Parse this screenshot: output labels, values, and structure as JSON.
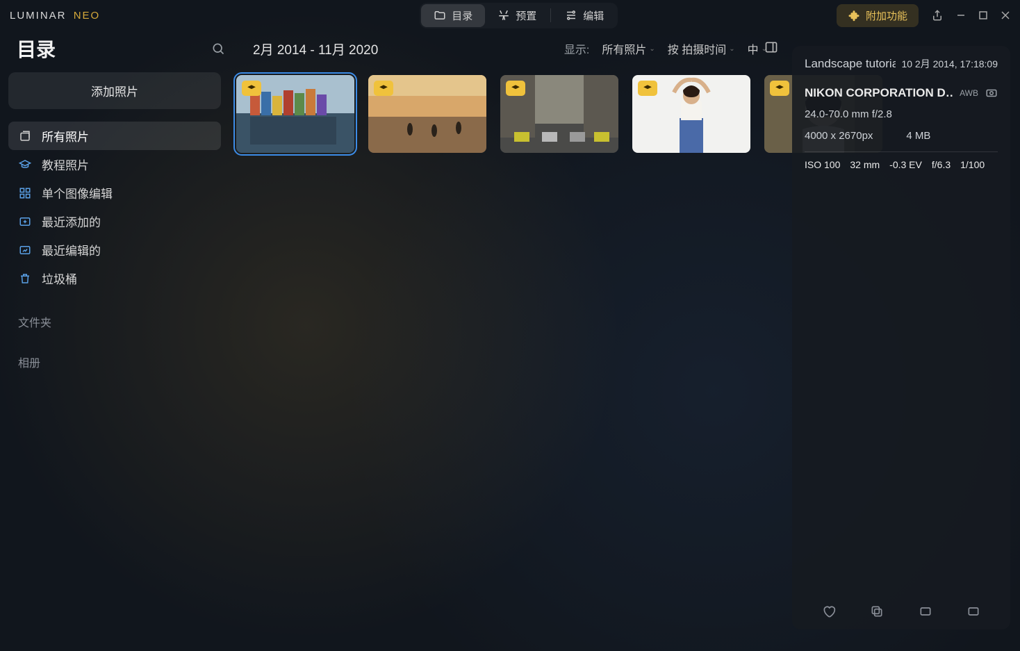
{
  "app": {
    "logo_a": "LUMINAR",
    "logo_b": "NEO"
  },
  "tabs": {
    "catalog": "目录",
    "presets": "预置",
    "edit": "编辑"
  },
  "addon_label": "附加功能",
  "sidebar_title": "目录",
  "date_range": "2月 2014 - 11月 2020",
  "filters": {
    "show_label": "显示:",
    "all_photos": "所有照片",
    "sort": "按 拍摄时间",
    "size": "中"
  },
  "add_photos": "添加照片",
  "nav": {
    "all": "所有照片",
    "tutorial": "教程照片",
    "single": "单个图像编辑",
    "recent_add": "最近添加的",
    "recent_edit": "最近编辑的",
    "trash": "垃圾桶"
  },
  "sections": {
    "folders": "文件夹",
    "albums": "相册"
  },
  "info": {
    "title": "Landscape tutoria",
    "date": "10 2月 2014, 17:18:09",
    "camera": "NIKON CORPORATION D…",
    "awb": "AWB",
    "lens": "24.0-70.0 mm f/2.8",
    "dimensions": "4000 x 2670px",
    "filesize": "4 MB",
    "iso": "ISO 100",
    "focal": "32 mm",
    "ev": "-0.3 EV",
    "aperture": "f/6.3",
    "shutter": "1/100"
  }
}
